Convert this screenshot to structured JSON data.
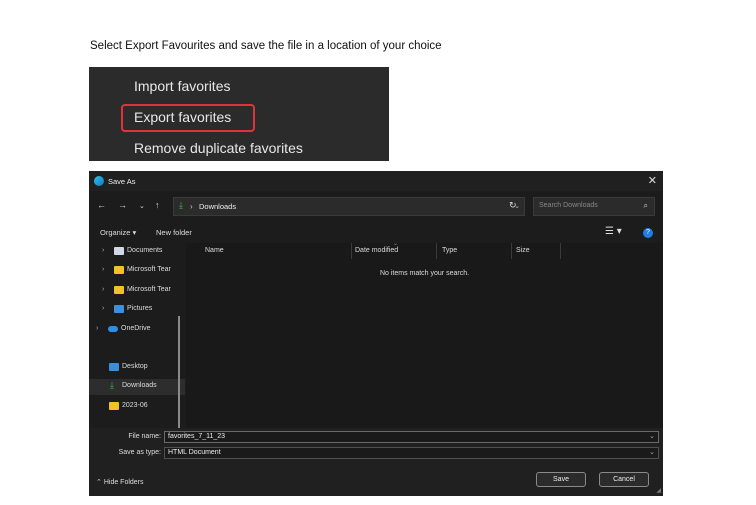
{
  "instruction": "Select Export Favourites and save the file in a location of your choice",
  "menu": {
    "items": [
      "Import favorites",
      "Export favorites",
      "Remove duplicate favorites"
    ],
    "highlight_color": "#e0323a"
  },
  "dialog": {
    "title": "Save As",
    "address_path": "Downloads",
    "search_placeholder": "Search Downloads",
    "commands": {
      "organize": "Organize ▾",
      "new_folder": "New folder"
    },
    "nav_items": [
      {
        "label": "Documents",
        "icon": "document-icon"
      },
      {
        "label": "Microsoft Tear",
        "icon": "folder-icon"
      },
      {
        "label": "Microsoft Tear",
        "icon": "folder-icon"
      },
      {
        "label": "Pictures",
        "icon": "pictures-icon"
      },
      {
        "label": "OneDrive",
        "icon": "cloud-icon"
      },
      {
        "label": "Desktop",
        "icon": "desktop-icon"
      },
      {
        "label": "Downloads",
        "icon": "download-icon"
      },
      {
        "label": "2023-06",
        "icon": "folder-icon"
      }
    ],
    "columns": [
      "Name",
      "Date modified",
      "Type",
      "Size"
    ],
    "empty_message": "No items match your search.",
    "file_name_label": "File name:",
    "file_name_value": "favorites_7_11_23",
    "save_type_label": "Save as type:",
    "save_type_value": "HTML Document",
    "hide_folders": "Hide Folders",
    "save_button": "Save",
    "cancel_button": "Cancel"
  }
}
